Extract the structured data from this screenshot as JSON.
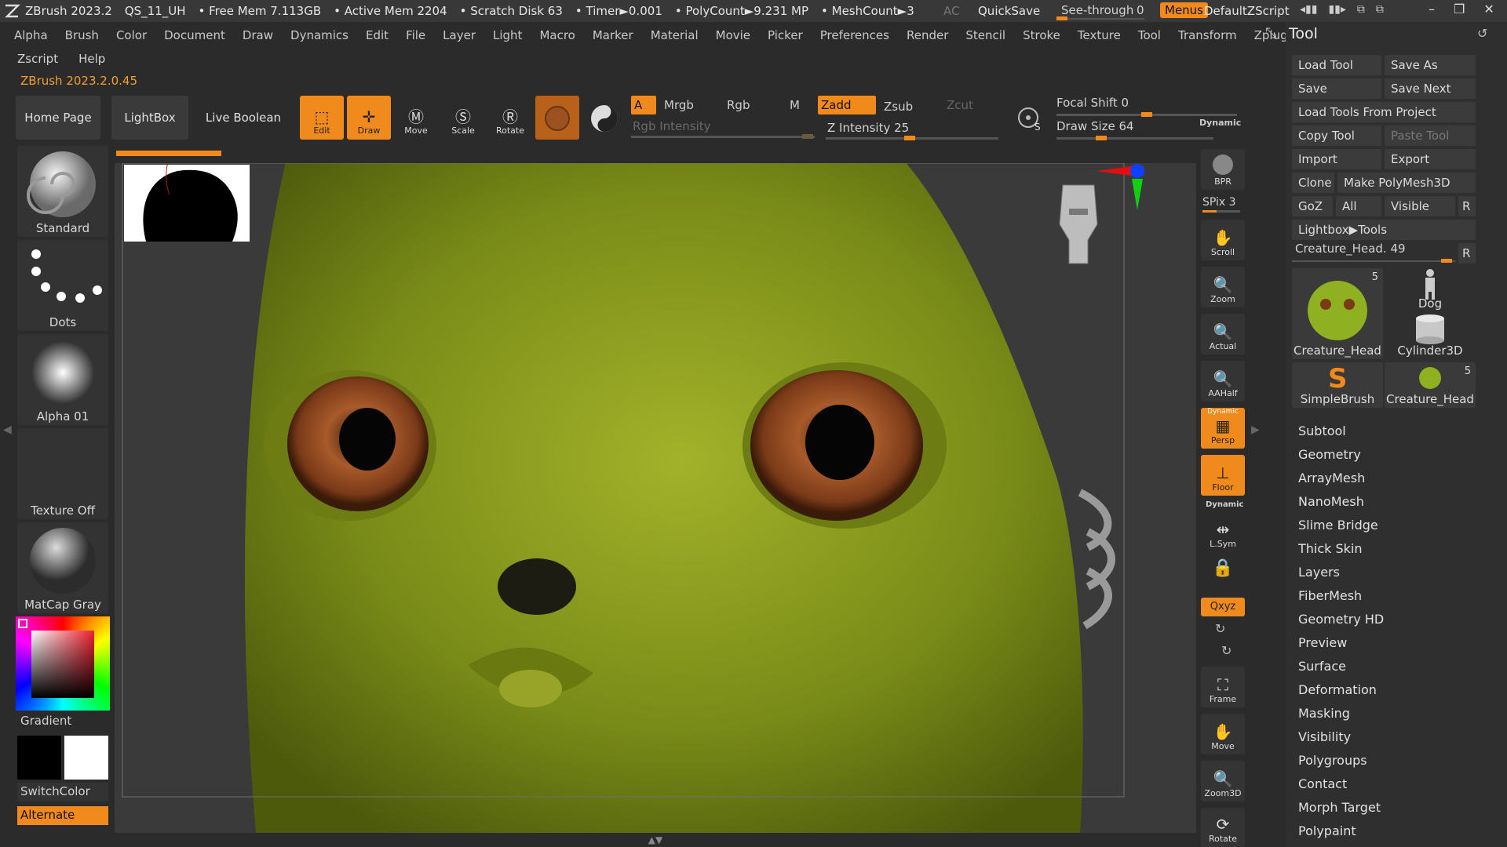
{
  "titlebar": {
    "app": "ZBrush 2023.2",
    "file": "QS_11_UH",
    "free_mem": "• Free Mem 7.113GB",
    "active_mem": "• Active Mem 2204",
    "scratch": "• Scratch Disk 63",
    "timer": "• Timer►0.001",
    "polycount": "• PolyCount►9.231 MP",
    "meshcount": "• MeshCount►3",
    "ac": "AC",
    "quicksave": "QuickSave",
    "seethrough": "See-through",
    "seethrough_value": "0",
    "menus": "Menus",
    "script": "DefaultZScript"
  },
  "menu": [
    "Alpha",
    "Brush",
    "Color",
    "Document",
    "Draw",
    "Dynamics",
    "Edit",
    "File",
    "Layer",
    "Light",
    "Macro",
    "Marker",
    "Material",
    "Movie",
    "Picker",
    "Preferences",
    "Render",
    "Stencil",
    "Stroke",
    "Texture",
    "Tool",
    "Transform",
    "Zplugin"
  ],
  "menu2": [
    "Zscript",
    "Help"
  ],
  "version": "ZBrush 2023.2.0.45",
  "toolbar": {
    "home": "Home Page",
    "lightbox": "LightBox",
    "liveboolean": "Live Boolean",
    "edit": "Edit",
    "draw": "Draw",
    "move": "Move",
    "scale": "Scale",
    "rotate": "Rotate",
    "a": "A",
    "mrgb": "Mrgb",
    "rgb": "Rgb",
    "m": "M",
    "zadd": "Zadd",
    "zsub": "Zsub",
    "zcut": "Zcut",
    "rgb_intensity": "Rgb Intensity",
    "z_intensity": "Z Intensity 25",
    "focal_shift": "Focal Shift 0",
    "draw_size": "Draw Size 64",
    "dynamic": "Dynamic",
    "s_icon_label": "S"
  },
  "shelf": {
    "brush": "Standard",
    "stroke": "Dots",
    "alpha": "Alpha 01",
    "texture": "Texture Off",
    "material": "MatCap Gray",
    "gradient": "Gradient",
    "switchcolor": "SwitchColor",
    "alternate": "Alternate"
  },
  "nav": {
    "bpr": "BPR",
    "spix": "SPix 3",
    "scroll": "Scroll",
    "zoom": "Zoom",
    "actual": "Actual",
    "aahalf": "AAHalf",
    "persp_top": "Dynamic",
    "persp": "Persp",
    "floor": "Floor",
    "lsym_top": "Dynamic",
    "lsym": "L.Sym",
    "xyz": "Qxyz",
    "frame": "Frame",
    "move": "Move",
    "zoom3d": "Zoom3D",
    "rotate": "Rotate"
  },
  "tool": {
    "title": "Tool",
    "load_tool": "Load Tool",
    "save_as": "Save As",
    "save": "Save",
    "save_next": "Save Next",
    "load_from_project": "Load Tools From Project",
    "copy_tool": "Copy Tool",
    "paste_tool": "Paste Tool",
    "import": "Import",
    "export": "Export",
    "clone": "Clone",
    "make_polymesh": "Make PolyMesh3D",
    "goz": "GoZ",
    "all": "All",
    "visible": "Visible",
    "r": "R",
    "lightbox_tools": "Lightbox▶Tools",
    "current_tool": "Creature_Head. 49",
    "thumbs": [
      {
        "label": "Creature_Head",
        "count": "5"
      },
      {
        "label": "Dog",
        "count": ""
      },
      {
        "label": "Cylinder3D",
        "count": ""
      },
      {
        "label": "SimpleBrush",
        "count": ""
      },
      {
        "label": "Creature_Head",
        "count": "5"
      }
    ],
    "subpalettes": [
      "Subtool",
      "Geometry",
      "ArrayMesh",
      "NanoMesh",
      "Slime Bridge",
      "Thick Skin",
      "Layers",
      "FiberMesh",
      "Geometry HD",
      "Preview",
      "Surface",
      "Deformation",
      "Masking",
      "Visibility",
      "Polygroups",
      "Contact",
      "Morph Target",
      "Polypaint"
    ]
  },
  "colors": {
    "accent": "#f08a1c",
    "creature": "#8a9c1e"
  }
}
